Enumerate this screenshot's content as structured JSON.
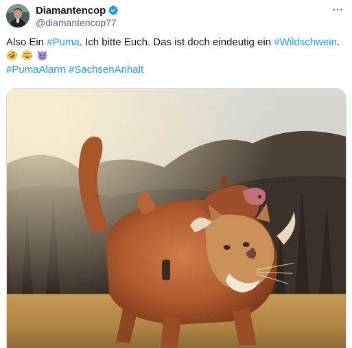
{
  "author": {
    "display_name": "Diamantencop",
    "handle": "@diamantencop77",
    "verified": true,
    "verified_color": "#1d9bf0",
    "avatar_icon": "profile-photo"
  },
  "more_icon": "ellipsis-icon",
  "tweet": {
    "line1": [
      {
        "type": "text",
        "value": "Also Ein "
      },
      {
        "type": "hashtag",
        "value": "#Puma"
      },
      {
        "type": "text",
        "value": ". Ich bitte Euch. Das ist doch eindeutig ein "
      },
      {
        "type": "hashtag",
        "value": "#Wildschwein"
      },
      {
        "type": "text",
        "value": "."
      }
    ],
    "emojis": [
      "rolling-on-floor-laughing-emoji",
      "tears-of-joy-emoji",
      "smiling-devil-emoji"
    ],
    "hashtags_line": [
      "#PumaAlarm",
      "#SachsenAnhalt"
    ]
  },
  "colors": {
    "hashtag": "#1d9bf0",
    "text": "#0f1419",
    "secondary_text": "#536471",
    "border": "#cfd9de"
  },
  "media": {
    "kind": "image",
    "subject": "composite-puma-wild-boar-image"
  }
}
